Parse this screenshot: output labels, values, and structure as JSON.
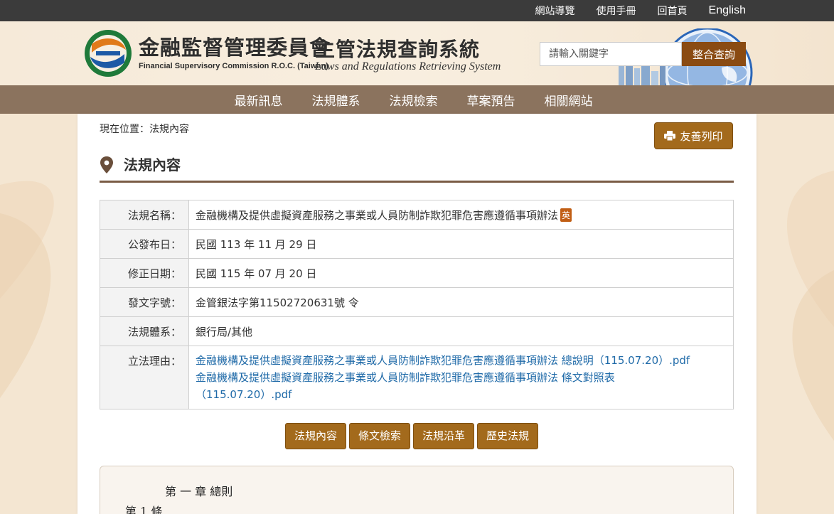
{
  "topbar": {
    "links": [
      "網站導覽",
      "使用手冊",
      "回首頁",
      "English"
    ]
  },
  "header": {
    "org_name_zh": "金融監督管理委員會",
    "org_name_en": "Financial Supervisory Commission R.O.C. (Taiwan)",
    "system_name_zh": "主管法規查詢系統",
    "system_name_en": "Laws and Regulations Retrieving System",
    "search": {
      "placeholder": "請輸入關鍵字",
      "button_label": "整合查詢"
    }
  },
  "nav": {
    "items": [
      "最新訊息",
      "法規體系",
      "法規檢索",
      "草案預告",
      "相關網站"
    ]
  },
  "breadcrumb": "現在位置：法規內容",
  "print_label": "友善列印",
  "page_title": "法規內容",
  "info": {
    "name_label": "法規名稱：",
    "name_value": "金融機構及提供虛擬資產服務之事業或人員防制詐欺犯罪危害應遵循事項辦法",
    "name_badge": "英",
    "announce_label": "公發布日：",
    "announce_value": "民國 113 年 11 月 29 日",
    "amend_label": "修正日期：",
    "amend_value": "民國 115 年 07 月 20 日",
    "doc_no_label": "發文字號：",
    "doc_no_value": "金管銀法字第11502720631號 令",
    "category_label": "法規體系：",
    "category_value": "銀行局/其他",
    "reason_label": "立法理由：",
    "reason_links": [
      "金融機構及提供虛擬資產服務之事業或人員防制詐欺犯罪危害應遵循事項辦法 總說明（115.07.20）.pdf",
      "金融機構及提供虛擬資產服務之事業或人員防制詐欺犯罪危害應遵循事項辦法 條文對照表",
      "（115.07.20）.pdf"
    ]
  },
  "actions": [
    "法規內容",
    "條文檢索",
    "法規沿革",
    "歷史法規"
  ],
  "law_body": {
    "chapter": "第 一 章 總則",
    "article": "第 1 條"
  },
  "colors": {
    "topbar": "#3b3b3b",
    "nav": "#8b735e",
    "accent_button": "#a36a1c",
    "search_button": "#8a4b12",
    "link": "#1f6aa8",
    "badge": "#c15e14"
  }
}
